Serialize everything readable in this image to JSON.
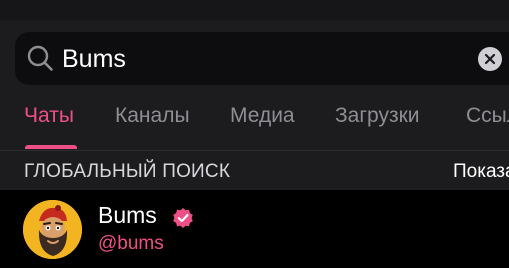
{
  "search": {
    "value": "Bums",
    "icon": "search-icon",
    "clear_icon": "clear-icon"
  },
  "tabs": [
    {
      "label": "Чаты",
      "active": true
    },
    {
      "label": "Каналы",
      "active": false
    },
    {
      "label": "Медиа",
      "active": false
    },
    {
      "label": "Загрузки",
      "active": false
    },
    {
      "label": "Ссылки",
      "active": false
    }
  ],
  "section": {
    "title": "ГЛОБАЛЬНЫЙ ПОИСК",
    "action": "Показать"
  },
  "results": [
    {
      "name": "Bums",
      "handle": "@bums",
      "verified": true,
      "avatar": "bearded-man-avatar"
    }
  ],
  "colors": {
    "accent": "#ee4f86",
    "background": "#1c1c1e",
    "search_bg": "#0d0d0f",
    "row_bg": "#000000",
    "inactive_tab": "#8e8e93",
    "avatar_bg": "#f2b420"
  }
}
